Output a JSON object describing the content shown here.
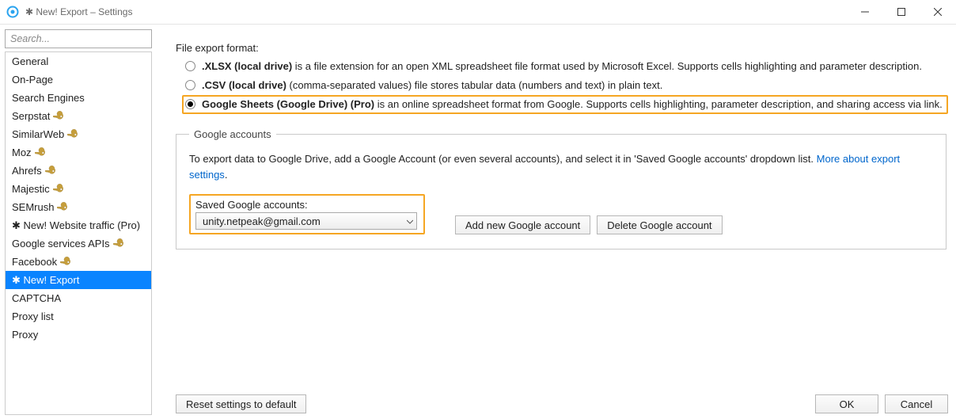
{
  "window": {
    "title": "✱ New! Export – Settings"
  },
  "sidebar": {
    "search_placeholder": "Search...",
    "items": [
      {
        "label": "General",
        "key": false,
        "selected": false
      },
      {
        "label": "On-Page",
        "key": false,
        "selected": false
      },
      {
        "label": "Search Engines",
        "key": false,
        "selected": false
      },
      {
        "label": "Serpstat",
        "key": true,
        "selected": false
      },
      {
        "label": "SimilarWeb",
        "key": true,
        "selected": false
      },
      {
        "label": "Moz",
        "key": true,
        "selected": false
      },
      {
        "label": "Ahrefs",
        "key": true,
        "selected": false
      },
      {
        "label": "Majestic",
        "key": true,
        "selected": false
      },
      {
        "label": "SEMrush",
        "key": true,
        "selected": false
      },
      {
        "label": "✱ New! Website traffic (Pro)",
        "key": false,
        "selected": false
      },
      {
        "label": "Google services APIs",
        "key": true,
        "selected": false
      },
      {
        "label": "Facebook",
        "key": true,
        "selected": false
      },
      {
        "label": "✱ New! Export",
        "key": false,
        "selected": true
      },
      {
        "label": "CAPTCHA",
        "key": false,
        "selected": false
      },
      {
        "label": "Proxy list",
        "key": false,
        "selected": false
      },
      {
        "label": "Proxy",
        "key": false,
        "selected": false
      }
    ]
  },
  "main": {
    "format_label": "File export format:",
    "options": [
      {
        "bold": ".XLSX (local drive)",
        "rest": " is a file extension for an open XML spreadsheet file format used by Microsoft Excel. Supports cells highlighting and parameter description.",
        "selected": false,
        "highlighted": false
      },
      {
        "bold": ".CSV (local drive)",
        "rest": " (comma-separated values) file stores tabular data (numbers and text) in plain text.",
        "selected": false,
        "highlighted": false
      },
      {
        "bold": "Google Sheets (Google Drive) (Pro)",
        "rest": " is an online spreadsheet format from Google. Supports cells highlighting, parameter description, and sharing access via link.",
        "selected": true,
        "highlighted": true
      }
    ],
    "accounts": {
      "legend": "Google accounts",
      "hint_prefix": "To export data to Google Drive, add a Google Account (or even several accounts), and select it in 'Saved Google accounts' dropdown list. ",
      "hint_link": "More about export settings",
      "hint_suffix": ".",
      "saved_label": "Saved Google accounts:",
      "selected_account": "unity.netpeak@gmail.com",
      "add_button": "Add new Google account",
      "delete_button": "Delete Google account"
    }
  },
  "footer": {
    "reset": "Reset settings to default",
    "ok": "OK",
    "cancel": "Cancel"
  }
}
